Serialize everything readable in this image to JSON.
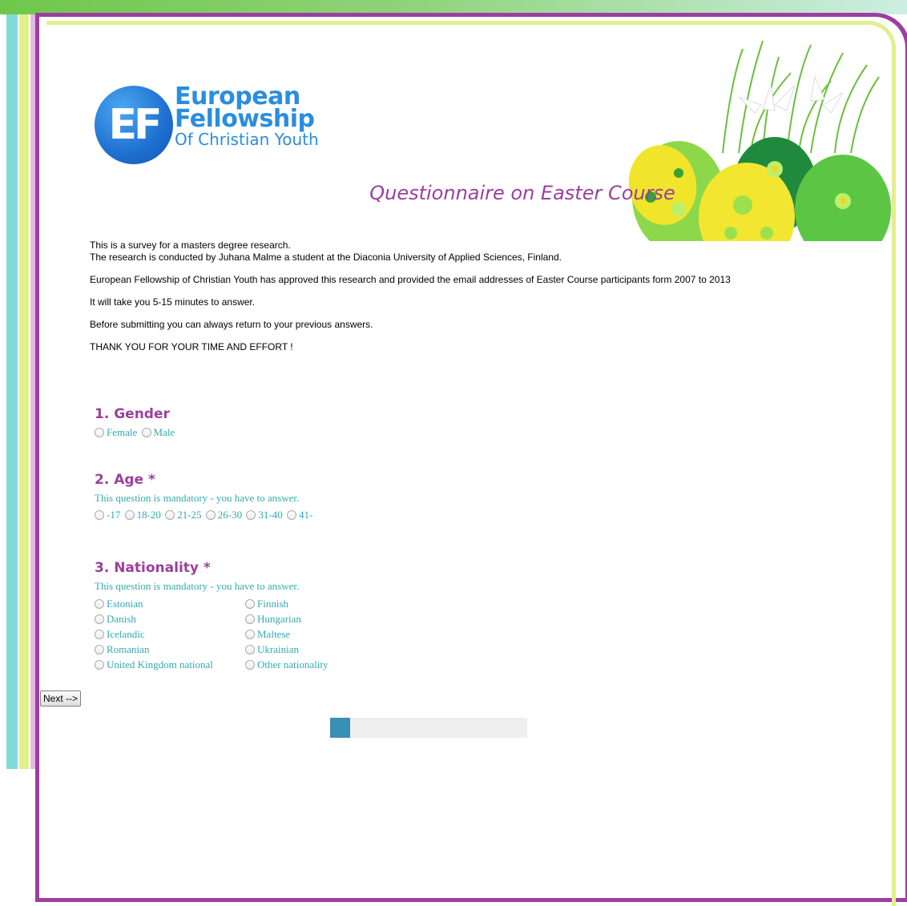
{
  "logo": {
    "monogram": "EF",
    "line1": "European",
    "line2": "Fellowship",
    "line3": "Of Christian Youth"
  },
  "title": "Questionnaire on Easter Course",
  "intro": {
    "line1": "This is a survey for a masters degree research.",
    "line2": "The research is conducted by Juhana Malme a student at the Diaconia University of Applied Sciences, Finland.",
    "line3": "European Fellowship of Christian Youth has approved this research and provided the email addresses of Easter Course participants form 2007 to 2013",
    "line4": "It will take you 5-15 minutes to answer.",
    "line5": "Before submitting you can always return to your previous answers.",
    "line6": "THANK YOU FOR YOUR TIME AND EFFORT !"
  },
  "questions": {
    "gender": {
      "title": "1. Gender",
      "options": [
        "Female",
        "Male"
      ]
    },
    "age": {
      "title": "2. Age *",
      "mandatory": "This question is mandatory - you have to answer.",
      "options": [
        "-17",
        "18-20",
        "21-25",
        "26-30",
        "31-40",
        "41-"
      ]
    },
    "nationality": {
      "title": "3. Nationality *",
      "mandatory": "This question is mandatory - you have to answer.",
      "options": [
        "Estonian",
        "Finnish",
        "Danish",
        "Hungarian",
        "Icelandic",
        "Maltese",
        "Romanian",
        "Ukrainian",
        "United Kingdom national",
        "Other nationality"
      ]
    }
  },
  "next_button": "Next -->",
  "progress": {
    "fraction": 0.1
  },
  "colors": {
    "accent_purple": "#9b3f9f",
    "option_teal": "#32aab2",
    "progress_blue": "#3a8fb7"
  }
}
